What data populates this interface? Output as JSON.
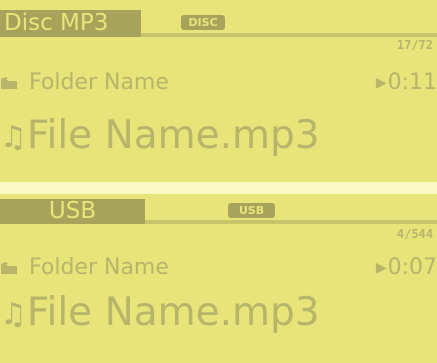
{
  "display_top": {
    "mode_label": "Disc MP3",
    "badge": "DISC",
    "track_counter": "17/72",
    "folder_name": "Folder Name",
    "file_name": "File Name.mp3",
    "play_time": "0:11"
  },
  "display_bottom": {
    "mode_label": "USB",
    "badge": "USB",
    "track_counter": "4/544",
    "folder_name": "Folder Name",
    "file_name": "File Name.mp3",
    "play_time": "0:07"
  },
  "colors": {
    "lcd_background": "#e8e47a",
    "tab_background": "#a7a35a",
    "text": "#b8b46a",
    "separator": "#fbf8c4"
  },
  "icons": {
    "folder": "folder-icon",
    "music": "music-note-icon",
    "play": "play-icon"
  }
}
